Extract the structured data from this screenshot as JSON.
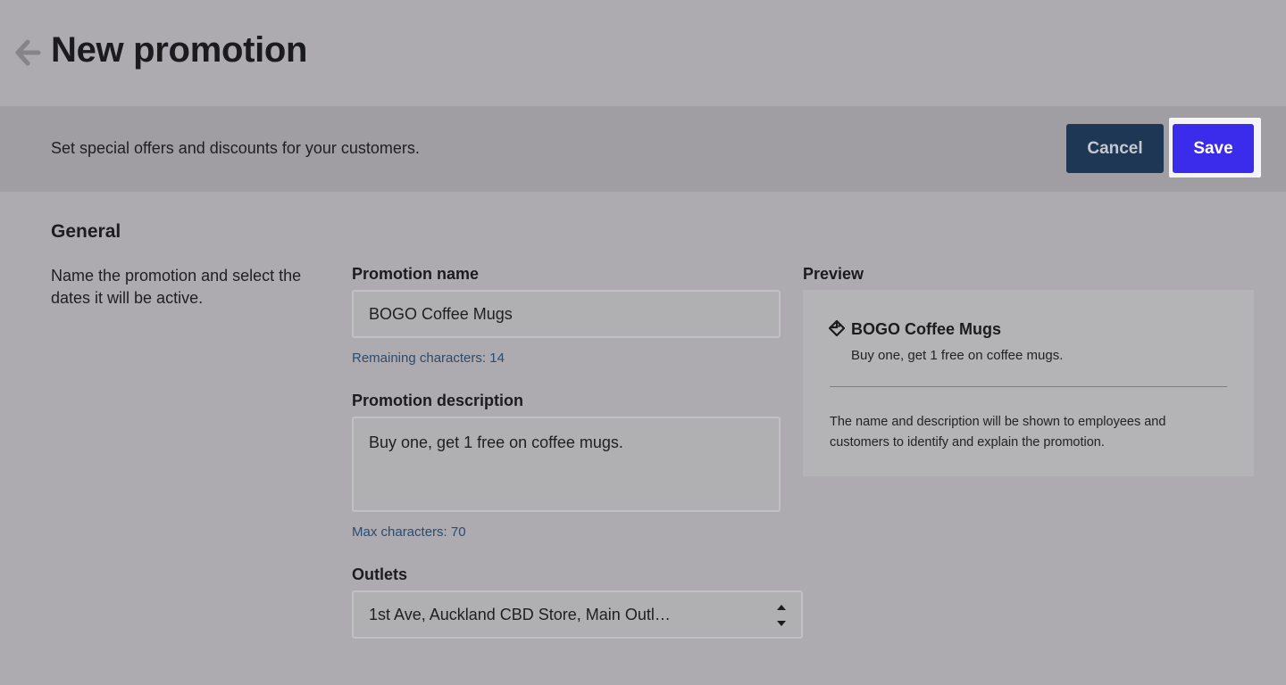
{
  "header": {
    "title": "New promotion",
    "back_icon": "arrow-left-icon"
  },
  "toolbar": {
    "description": "Set special offers and discounts for your customers.",
    "cancel_label": "Cancel",
    "save_label": "Save"
  },
  "general": {
    "title": "General",
    "description": "Name the promotion and select the dates it will be active.",
    "promotion_name": {
      "label": "Promotion name",
      "value": "BOGO Coffee Mugs",
      "hint": "Remaining characters: 14"
    },
    "promotion_description": {
      "label": "Promotion description",
      "value": "Buy one, get 1 free on coffee mugs.",
      "hint": "Max characters: 70"
    },
    "outlets": {
      "label": "Outlets",
      "selected": "1st Ave, Auckland CBD Store, Main Outl…",
      "icon": "updown-stepper-icon"
    }
  },
  "preview": {
    "label": "Preview",
    "icon": "tag-icon",
    "name": "BOGO Coffee Mugs",
    "description": "Buy one, get 1 free on coffee mugs.",
    "note": "The name and description will be shown to employees and customers to identify and explain the promotion."
  },
  "colors": {
    "background": "#adabaf",
    "toolbar_band": "#a09ea2",
    "cancel_button": "#1e3754",
    "save_button": "#3b2bea",
    "hint_text": "#2c4b6d"
  }
}
